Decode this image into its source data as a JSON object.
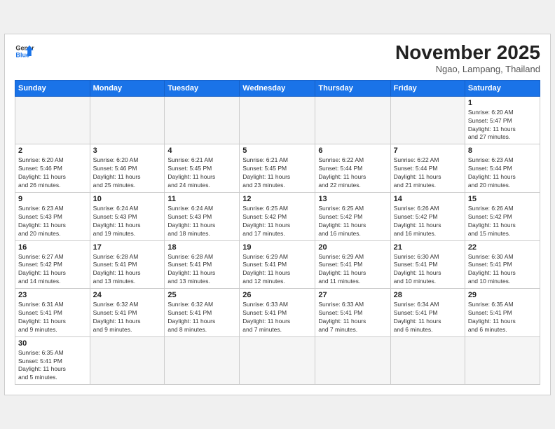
{
  "header": {
    "logo_general": "General",
    "logo_blue": "Blue",
    "month_title": "November 2025",
    "location": "Ngao, Lampang, Thailand"
  },
  "weekdays": [
    "Sunday",
    "Monday",
    "Tuesday",
    "Wednesday",
    "Thursday",
    "Friday",
    "Saturday"
  ],
  "days": [
    {
      "num": "",
      "info": ""
    },
    {
      "num": "",
      "info": ""
    },
    {
      "num": "",
      "info": ""
    },
    {
      "num": "",
      "info": ""
    },
    {
      "num": "",
      "info": ""
    },
    {
      "num": "",
      "info": ""
    },
    {
      "num": "1",
      "info": "Sunrise: 6:20 AM\nSunset: 5:47 PM\nDaylight: 11 hours\nand 27 minutes."
    },
    {
      "num": "2",
      "info": "Sunrise: 6:20 AM\nSunset: 5:46 PM\nDaylight: 11 hours\nand 26 minutes."
    },
    {
      "num": "3",
      "info": "Sunrise: 6:20 AM\nSunset: 5:46 PM\nDaylight: 11 hours\nand 25 minutes."
    },
    {
      "num": "4",
      "info": "Sunrise: 6:21 AM\nSunset: 5:45 PM\nDaylight: 11 hours\nand 24 minutes."
    },
    {
      "num": "5",
      "info": "Sunrise: 6:21 AM\nSunset: 5:45 PM\nDaylight: 11 hours\nand 23 minutes."
    },
    {
      "num": "6",
      "info": "Sunrise: 6:22 AM\nSunset: 5:44 PM\nDaylight: 11 hours\nand 22 minutes."
    },
    {
      "num": "7",
      "info": "Sunrise: 6:22 AM\nSunset: 5:44 PM\nDaylight: 11 hours\nand 21 minutes."
    },
    {
      "num": "8",
      "info": "Sunrise: 6:23 AM\nSunset: 5:44 PM\nDaylight: 11 hours\nand 20 minutes."
    },
    {
      "num": "9",
      "info": "Sunrise: 6:23 AM\nSunset: 5:43 PM\nDaylight: 11 hours\nand 20 minutes."
    },
    {
      "num": "10",
      "info": "Sunrise: 6:24 AM\nSunset: 5:43 PM\nDaylight: 11 hours\nand 19 minutes."
    },
    {
      "num": "11",
      "info": "Sunrise: 6:24 AM\nSunset: 5:43 PM\nDaylight: 11 hours\nand 18 minutes."
    },
    {
      "num": "12",
      "info": "Sunrise: 6:25 AM\nSunset: 5:42 PM\nDaylight: 11 hours\nand 17 minutes."
    },
    {
      "num": "13",
      "info": "Sunrise: 6:25 AM\nSunset: 5:42 PM\nDaylight: 11 hours\nand 16 minutes."
    },
    {
      "num": "14",
      "info": "Sunrise: 6:26 AM\nSunset: 5:42 PM\nDaylight: 11 hours\nand 16 minutes."
    },
    {
      "num": "15",
      "info": "Sunrise: 6:26 AM\nSunset: 5:42 PM\nDaylight: 11 hours\nand 15 minutes."
    },
    {
      "num": "16",
      "info": "Sunrise: 6:27 AM\nSunset: 5:42 PM\nDaylight: 11 hours\nand 14 minutes."
    },
    {
      "num": "17",
      "info": "Sunrise: 6:28 AM\nSunset: 5:41 PM\nDaylight: 11 hours\nand 13 minutes."
    },
    {
      "num": "18",
      "info": "Sunrise: 6:28 AM\nSunset: 5:41 PM\nDaylight: 11 hours\nand 13 minutes."
    },
    {
      "num": "19",
      "info": "Sunrise: 6:29 AM\nSunset: 5:41 PM\nDaylight: 11 hours\nand 12 minutes."
    },
    {
      "num": "20",
      "info": "Sunrise: 6:29 AM\nSunset: 5:41 PM\nDaylight: 11 hours\nand 11 minutes."
    },
    {
      "num": "21",
      "info": "Sunrise: 6:30 AM\nSunset: 5:41 PM\nDaylight: 11 hours\nand 10 minutes."
    },
    {
      "num": "22",
      "info": "Sunrise: 6:30 AM\nSunset: 5:41 PM\nDaylight: 11 hours\nand 10 minutes."
    },
    {
      "num": "23",
      "info": "Sunrise: 6:31 AM\nSunset: 5:41 PM\nDaylight: 11 hours\nand 9 minutes."
    },
    {
      "num": "24",
      "info": "Sunrise: 6:32 AM\nSunset: 5:41 PM\nDaylight: 11 hours\nand 9 minutes."
    },
    {
      "num": "25",
      "info": "Sunrise: 6:32 AM\nSunset: 5:41 PM\nDaylight: 11 hours\nand 8 minutes."
    },
    {
      "num": "26",
      "info": "Sunrise: 6:33 AM\nSunset: 5:41 PM\nDaylight: 11 hours\nand 7 minutes."
    },
    {
      "num": "27",
      "info": "Sunrise: 6:33 AM\nSunset: 5:41 PM\nDaylight: 11 hours\nand 7 minutes."
    },
    {
      "num": "28",
      "info": "Sunrise: 6:34 AM\nSunset: 5:41 PM\nDaylight: 11 hours\nand 6 minutes."
    },
    {
      "num": "29",
      "info": "Sunrise: 6:35 AM\nSunset: 5:41 PM\nDaylight: 11 hours\nand 6 minutes."
    },
    {
      "num": "30",
      "info": "Sunrise: 6:35 AM\nSunset: 5:41 PM\nDaylight: 11 hours\nand 5 minutes."
    },
    {
      "num": "",
      "info": ""
    },
    {
      "num": "",
      "info": ""
    },
    {
      "num": "",
      "info": ""
    },
    {
      "num": "",
      "info": ""
    },
    {
      "num": "",
      "info": ""
    },
    {
      "num": "",
      "info": ""
    }
  ]
}
